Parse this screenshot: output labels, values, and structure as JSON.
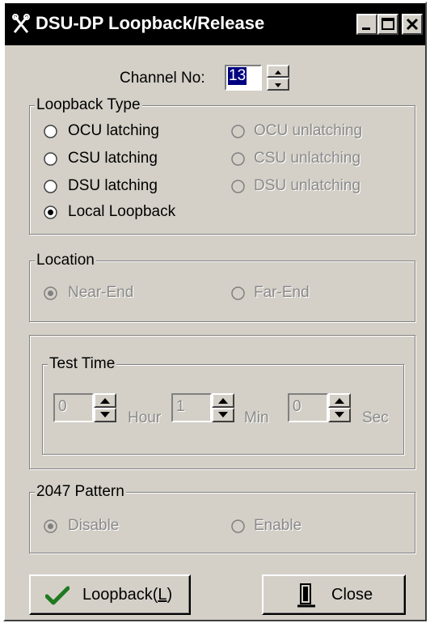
{
  "window": {
    "title": "DSU-DP Loopback/Release"
  },
  "channel": {
    "label": "Channel No:",
    "value": "13"
  },
  "loopback_type": {
    "legend": "Loopback Type",
    "options": [
      {
        "label": "OCU latching",
        "enabled": true,
        "selected": false
      },
      {
        "label": "OCU unlatching",
        "enabled": false,
        "selected": false
      },
      {
        "label": "CSU latching",
        "enabled": true,
        "selected": false
      },
      {
        "label": "CSU unlatching",
        "enabled": false,
        "selected": false
      },
      {
        "label": "DSU latching",
        "enabled": true,
        "selected": false
      },
      {
        "label": "DSU unlatching",
        "enabled": false,
        "selected": false
      },
      {
        "label": "Local Loopback",
        "enabled": true,
        "selected": true
      }
    ]
  },
  "location": {
    "legend": "Location",
    "options": [
      {
        "label": "Near-End",
        "enabled": false,
        "selected": true
      },
      {
        "label": "Far-End",
        "enabled": false,
        "selected": false
      }
    ]
  },
  "test_time": {
    "legend": "Test Time",
    "hour": {
      "value": "0",
      "unit": "Hour"
    },
    "min": {
      "value": "1",
      "unit": "Min"
    },
    "sec": {
      "value": "0",
      "unit": "Sec"
    }
  },
  "pattern": {
    "legend": "2047 Pattern",
    "options": [
      {
        "label": "Disable",
        "enabled": false,
        "selected": true
      },
      {
        "label": "Enable",
        "enabled": false,
        "selected": false
      }
    ]
  },
  "buttons": {
    "loopback_prefix": "Loopback(",
    "loopback_hotkey": "L",
    "loopback_suffix": ")",
    "close": "Close"
  },
  "colors": {
    "face": "#d4d0c8",
    "titlebar": "#000000",
    "highlight": "#000080",
    "disabled_text": "#8a8a8a",
    "check": "#1f7a1f"
  },
  "icons": {
    "app": "tools-icon",
    "loopback": "checkmark-icon",
    "close": "door-icon"
  }
}
